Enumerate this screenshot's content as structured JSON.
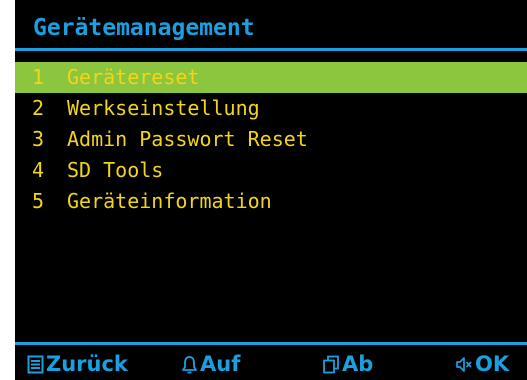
{
  "title": "Gerätemanagement",
  "menu": {
    "items": [
      {
        "number": "1",
        "label": "Gerätereset",
        "selected": true
      },
      {
        "number": "2",
        "label": "Werkseinstellung",
        "selected": false
      },
      {
        "number": "3",
        "label": "Admin Passwort Reset",
        "selected": false
      },
      {
        "number": "4",
        "label": "SD Tools",
        "selected": false
      },
      {
        "number": "5",
        "label": "Geräteinformation",
        "selected": false
      }
    ]
  },
  "softkeys": {
    "back": {
      "label": "Zurück",
      "icon": "menu-list-icon"
    },
    "up": {
      "label": "Auf",
      "icon": "bell-icon"
    },
    "down": {
      "label": "Ab",
      "icon": "copy-icon"
    },
    "ok": {
      "label": "OK",
      "icon": "speaker-icon"
    }
  },
  "colors": {
    "background": "#000000",
    "accent": "#1a9fe0",
    "text": "#f2d51b",
    "highlight": "#8cc63e"
  }
}
